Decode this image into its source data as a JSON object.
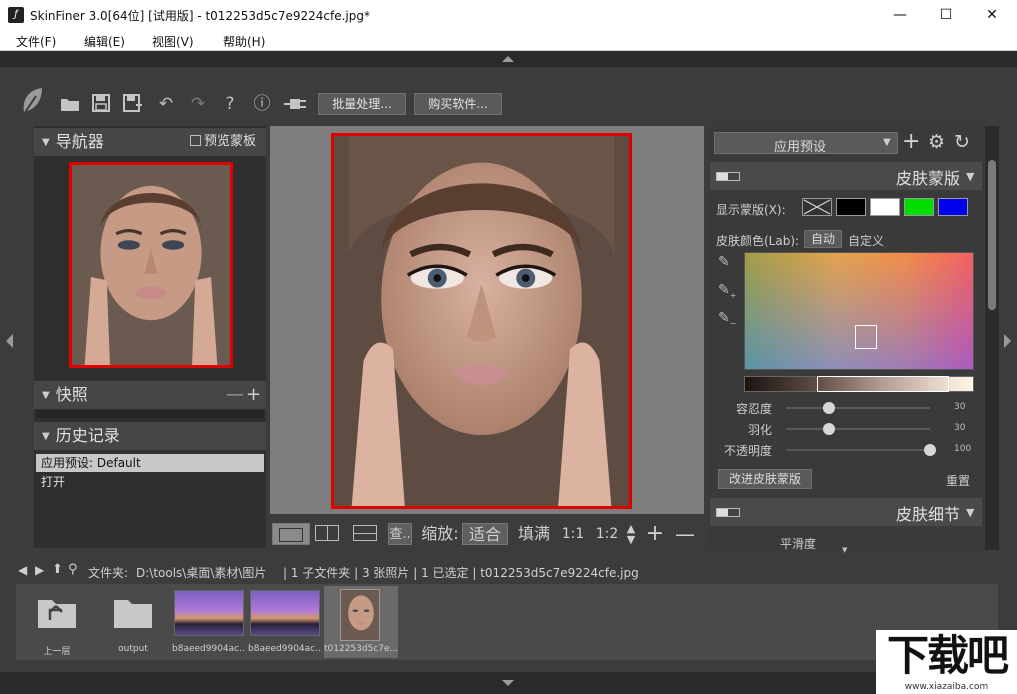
{
  "window": {
    "title": "SkinFiner 3.0[64位] [试用版] - t012253d5c7e9224cfe.jpg*",
    "minimize": "—",
    "maximize": "☐",
    "close": "✕"
  },
  "menu": [
    "文件(F)",
    "编辑(E)",
    "视图(V)",
    "帮助(H)"
  ],
  "toolbar": {
    "batch_label": "批量处理...",
    "buy_label": "购买软件..."
  },
  "navigator": {
    "title": "导航器",
    "preview_mask": "预览蒙板"
  },
  "snapshots": {
    "title": "快照"
  },
  "history": {
    "title": "历史记录",
    "items": [
      "应用预设: Default",
      "打开"
    ]
  },
  "zoom": {
    "label": "缩放:",
    "fit": "适合",
    "fill": "填满",
    "one_to_one": "1:1",
    "one_to_two": "1:2",
    "find": "查.."
  },
  "right": {
    "preset_label": "应用预设",
    "skin_mask_title": "皮肤蒙版",
    "show_mask": "显示蒙版(X):",
    "skin_color": "皮肤颜色(Lab):",
    "auto": "自动",
    "custom": "自定义",
    "tolerance": "容忍度",
    "tolerance_value": "30",
    "feather": "羽化",
    "feather_value": "30",
    "opacity": "不透明度",
    "opacity_value": "100",
    "improve_mask": "改进皮肤蒙版",
    "reset": "重置",
    "skin_detail_title": "皮肤细节",
    "smoothness": "平滑度",
    "tolerance_level": 0.3,
    "feather_level": 0.3,
    "opacity_level": 1.0
  },
  "pathbar": {
    "folder_label": "文件夹:",
    "path": "D:\\tools\\桌面\\素材\\图片",
    "info": "| 1 子文件夹 | 3 张照片 | 1 已选定 | t012253d5c7e9224cfe.jpg"
  },
  "filmstrip": [
    {
      "label": "上一层",
      "kind": "up-folder"
    },
    {
      "label": "output",
      "kind": "folder"
    },
    {
      "label": "b8aeed9904ac...",
      "kind": "photo"
    },
    {
      "label": "b8aeed9904ac...",
      "kind": "photo"
    },
    {
      "label": "t012253d5c7e...",
      "kind": "photo-selected"
    }
  ],
  "watermark": {
    "logo": "下载吧",
    "url": "www.xiazaiba.com"
  },
  "colors": {
    "accent_red": "#e00000",
    "mask_green": "#00dd00",
    "mask_blue": "#0000ee"
  }
}
